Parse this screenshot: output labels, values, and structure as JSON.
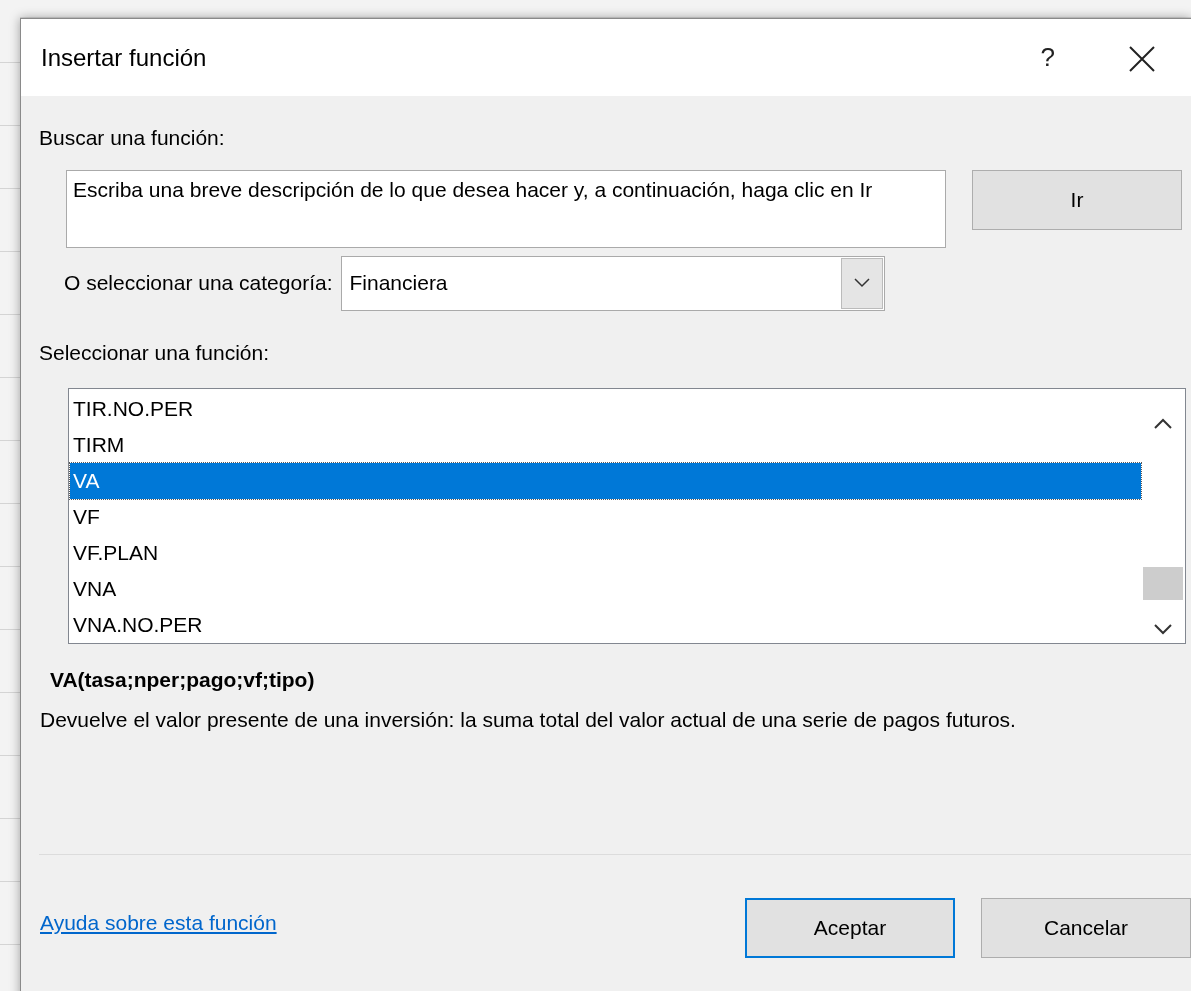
{
  "window": {
    "title": "Insertar función",
    "help_button": "?"
  },
  "search": {
    "label": "Buscar una función:",
    "value": "Escriba una breve descripción de lo que desea hacer y, a continuación, haga clic en Ir",
    "button": "Ir"
  },
  "category": {
    "label": "O seleccionar una categoría:",
    "value": "Financiera"
  },
  "function_list": {
    "label": "Seleccionar una función:",
    "items": [
      {
        "name": "TIR.NO.PER",
        "selected": false
      },
      {
        "name": "TIRM",
        "selected": false
      },
      {
        "name": "VA",
        "selected": true
      },
      {
        "name": "VF",
        "selected": false
      },
      {
        "name": "VF.PLAN",
        "selected": false
      },
      {
        "name": "VNA",
        "selected": false
      },
      {
        "name": "VNA.NO.PER",
        "selected": false
      }
    ]
  },
  "signature": "VA(tasa;nper;pago;vf;tipo)",
  "description": "Devuelve el valor presente de una inversión: la suma total del valor actual de una serie de pagos futuros.",
  "help_link": "Ayuda sobre esta función",
  "buttons": [
    {
      "label": "Aceptar",
      "default": true
    },
    {
      "label": "Cancelar",
      "default": false
    }
  ]
}
